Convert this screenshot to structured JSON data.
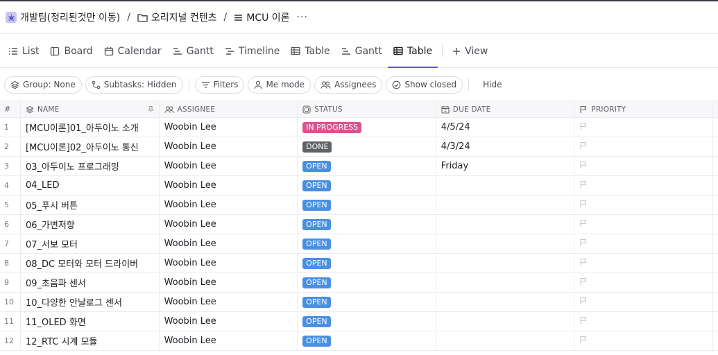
{
  "breadcrumb": {
    "space": "개발팀(정리된것만 이동)",
    "folder": "오리지널 컨텐츠",
    "list": "MCU 이론",
    "separator": "/",
    "more": "···"
  },
  "tabs": [
    {
      "label": "List",
      "icon": "list-icon"
    },
    {
      "label": "Board",
      "icon": "board-icon"
    },
    {
      "label": "Calendar",
      "icon": "calendar-icon"
    },
    {
      "label": "Gantt",
      "icon": "gantt-icon"
    },
    {
      "label": "Timeline",
      "icon": "timeline-icon"
    },
    {
      "label": "Table",
      "icon": "table-icon"
    },
    {
      "label": "Gantt",
      "icon": "gantt-icon"
    },
    {
      "label": "Table",
      "icon": "table-icon",
      "active": true
    }
  ],
  "add_view_label": "View",
  "toolbar": {
    "group": "Group: None",
    "subtasks": "Subtasks: Hidden",
    "filters": "Filters",
    "me_mode": "Me mode",
    "assignees": "Assignees",
    "show_closed": "Show closed",
    "hide": "Hide"
  },
  "columns": {
    "num": "#",
    "name": "NAME",
    "assignee": "ASSIGNEE",
    "status": "STATUS",
    "due_date": "DUE DATE",
    "priority": "PRIORITY"
  },
  "status_colors": {
    "IN PROGRESS": "#d9548f",
    "DONE": "#5f6368",
    "OPEN": "#4a90e2"
  },
  "rows": [
    {
      "num": "1",
      "name": "[MCU이론]01_아두이노 소개",
      "assignee": "Woobin Lee",
      "status": "IN PROGRESS",
      "due": "4/5/24"
    },
    {
      "num": "2",
      "name": "[MCU이론]02_아두이노 통신",
      "assignee": "Woobin Lee",
      "status": "DONE",
      "due": "4/3/24"
    },
    {
      "num": "3",
      "name": "03_아두이노 프로그래밍",
      "assignee": "Woobin Lee",
      "status": "OPEN",
      "due": "Friday"
    },
    {
      "num": "4",
      "name": "04_LED",
      "assignee": "Woobin Lee",
      "status": "OPEN",
      "due": ""
    },
    {
      "num": "5",
      "name": "05_푸시 버튼",
      "assignee": "Woobin Lee",
      "status": "OPEN",
      "due": ""
    },
    {
      "num": "6",
      "name": "06_가변저항",
      "assignee": "Woobin Lee",
      "status": "OPEN",
      "due": ""
    },
    {
      "num": "7",
      "name": "07_서보 모터",
      "assignee": "Woobin Lee",
      "status": "OPEN",
      "due": ""
    },
    {
      "num": "8",
      "name": "08_DC 모터와 모터 드라이버",
      "assignee": "Woobin Lee",
      "status": "OPEN",
      "due": ""
    },
    {
      "num": "9",
      "name": "09_초음파 센서",
      "assignee": "Woobin Lee",
      "status": "OPEN",
      "due": ""
    },
    {
      "num": "10",
      "name": "10_다양한 안날로그 센서",
      "assignee": "Woobin Lee",
      "status": "OPEN",
      "due": ""
    },
    {
      "num": "11",
      "name": "11_OLED 화면",
      "assignee": "Woobin Lee",
      "status": "OPEN",
      "due": ""
    },
    {
      "num": "12",
      "name": "12_RTC 시계 모듈",
      "assignee": "Woobin Lee",
      "status": "OPEN",
      "due": ""
    }
  ]
}
